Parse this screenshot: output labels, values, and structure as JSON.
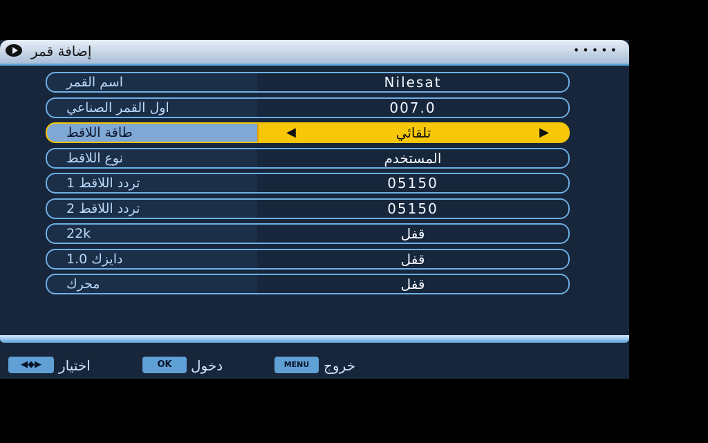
{
  "title": "إضافة قمر",
  "title_dots": "•••••",
  "rows": [
    {
      "label": "اسم القمر",
      "value": "Nilesat"
    },
    {
      "label": "اول القمر الصناعي",
      "value": "007.0"
    },
    {
      "label": "طاقة اللاقط",
      "value": "تلقائي",
      "selected": true,
      "left_arrow": "◀",
      "right_arrow": "▶"
    },
    {
      "label": "نوع اللاقط",
      "value": "المستخدم"
    },
    {
      "label": "تردد اللاقط 1",
      "value": "05150"
    },
    {
      "label": "تردد اللاقط 2",
      "value": "05150"
    },
    {
      "label": "22k",
      "value": "قفل"
    },
    {
      "label": "دايزك 1.0",
      "value": "قفل"
    },
    {
      "label": "محرك",
      "value": "قفل"
    }
  ],
  "footer": {
    "arrows_key": "◀◆▶",
    "select_label": "اختيار",
    "ok_key": "OK",
    "enter_label": "دخول",
    "menu_key": "MENU",
    "exit_label": "خروج"
  },
  "colors": {
    "selected_value_bg": "#f8c707",
    "row_border": "#6fb0e6",
    "screen_bg": "#17263a"
  }
}
